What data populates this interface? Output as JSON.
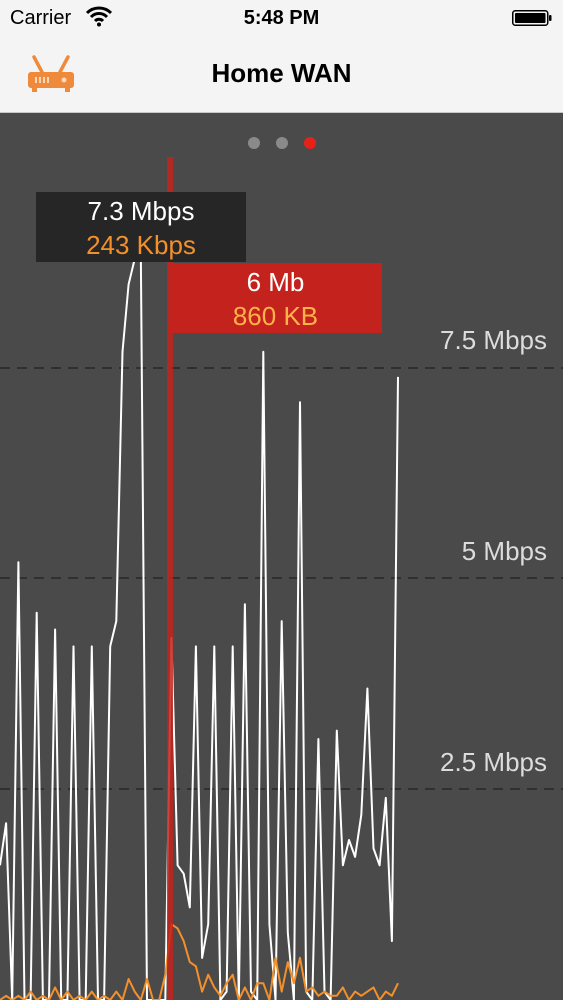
{
  "status_bar": {
    "carrier": "Carrier",
    "time": "5:48 PM"
  },
  "nav": {
    "title": "Home WAN",
    "left_icon": "router-icon"
  },
  "page_indicator": {
    "count": 3,
    "active_index": 2
  },
  "colors": {
    "accent": "#e8201a",
    "download_line": "#ffffff",
    "upload_line": "#f3902a",
    "cursor_line": "#c4221c",
    "router_icon": "#ef8a3c"
  },
  "tooltip_rate": {
    "download": "7.3 Mbps",
    "upload": "243 Kbps"
  },
  "tooltip_total": {
    "download": "6 Mb",
    "upload": "860 KB"
  },
  "chart_data": {
    "type": "line",
    "y_tick_labels": [
      "7.5 Mbps",
      "5 Mbps",
      "2.5 Mbps"
    ],
    "y_ticks": [
      7.5,
      5,
      2.5
    ],
    "ylim": [
      0,
      10
    ],
    "grid": "dashed-horizontal",
    "cursor_index": 27,
    "series": [
      {
        "color": "#ffffff",
        "values": [
          1.6,
          2.1,
          0,
          5.2,
          0,
          0,
          4.6,
          0,
          0,
          4.4,
          0,
          0,
          4.2,
          0,
          0,
          4.2,
          0,
          0,
          4.2,
          4.5,
          7.7,
          8.5,
          8.8,
          8.9,
          0,
          0,
          0,
          0,
          4.3,
          1.6,
          1.5,
          1.1,
          4.2,
          0.5,
          0.9,
          4.2,
          0,
          0.1,
          4.2,
          0,
          4.7,
          0.1,
          0,
          7.7,
          0.9,
          0,
          4.5,
          0.8,
          0,
          7.1,
          0.1,
          0,
          3.1,
          0.1,
          0,
          3.2,
          1.6,
          1.9,
          1.7,
          2.2,
          3.7,
          1.8,
          1.6,
          2.4,
          0.7,
          7.4
        ]
      },
      {
        "color": "#f3902a",
        "values": [
          0,
          0.05,
          0,
          0.05,
          0,
          0.1,
          0,
          0.05,
          0,
          0.15,
          0,
          0.1,
          0,
          0.05,
          0,
          0.1,
          0,
          0.05,
          0,
          0.1,
          0,
          0.25,
          0.1,
          0,
          0.25,
          0,
          0,
          0.3,
          0.9,
          0.85,
          0.7,
          0.45,
          0.4,
          0.1,
          0.3,
          0.15,
          0.05,
          0.2,
          0.3,
          0,
          0.15,
          0,
          0.2,
          0.2,
          0,
          0.5,
          0.1,
          0.45,
          0.2,
          0.5,
          0.1,
          0.15,
          0.05,
          0.1,
          0.05,
          0.05,
          0.15,
          0,
          0.1,
          0.05,
          0.1,
          0.15,
          0,
          0.1,
          0.05,
          0.2
        ]
      }
    ]
  }
}
